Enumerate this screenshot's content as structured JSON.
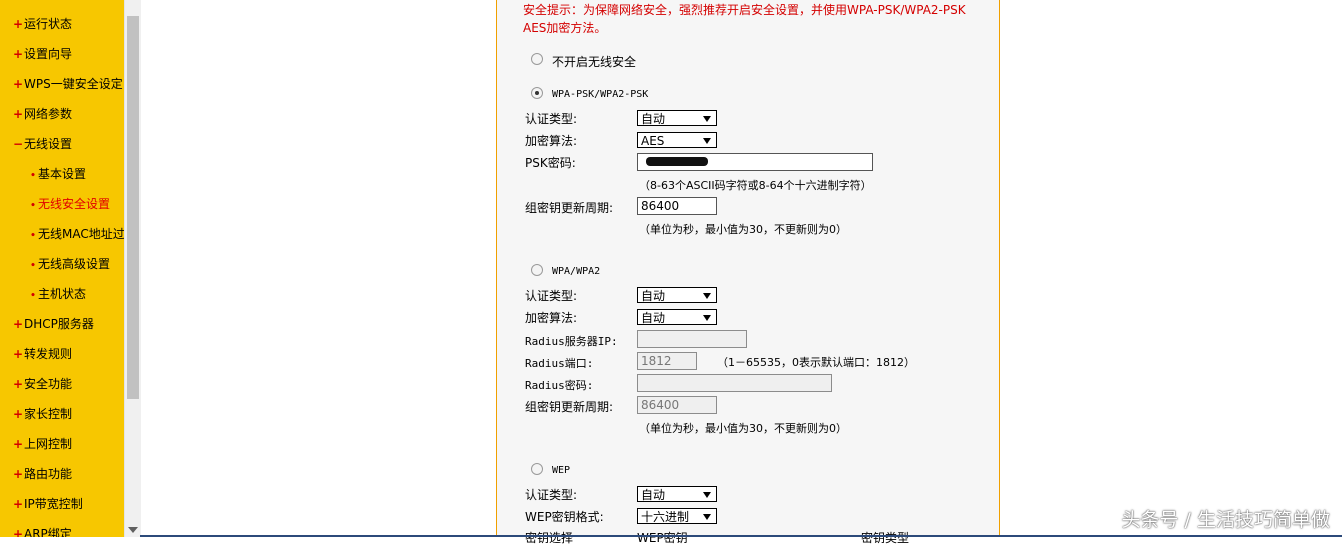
{
  "sidebar": {
    "items": [
      {
        "label": "运行状态",
        "mark": "+"
      },
      {
        "label": "设置向导",
        "mark": "+"
      },
      {
        "label": "WPS一键安全设定",
        "mark": "+"
      },
      {
        "label": "网络参数",
        "mark": "+"
      },
      {
        "label": "无线设置",
        "mark": "−"
      },
      {
        "label": "基本设置",
        "mark": "•"
      },
      {
        "label": "无线安全设置",
        "mark": "•"
      },
      {
        "label": "无线MAC地址过滤",
        "mark": "•"
      },
      {
        "label": "无线高级设置",
        "mark": "•"
      },
      {
        "label": "主机状态",
        "mark": "•"
      },
      {
        "label": "DHCP服务器",
        "mark": "+"
      },
      {
        "label": "转发规则",
        "mark": "+"
      },
      {
        "label": "安全功能",
        "mark": "+"
      },
      {
        "label": "家长控制",
        "mark": "+"
      },
      {
        "label": "上网控制",
        "mark": "+"
      },
      {
        "label": "路由功能",
        "mark": "+"
      },
      {
        "label": "IP带宽控制",
        "mark": "+"
      },
      {
        "label": "ARP绑定",
        "mark": "+"
      }
    ],
    "active_label": "无线安全设置"
  },
  "notice": "安全提示：为保障网络安全，强烈推荐开启安全设置，并使用WPA-PSK/WPA2-PSK AES加密方法。",
  "options": {
    "none": {
      "label": "不开启无线安全",
      "checked": false
    },
    "wpa_psk": {
      "label": "WPA-PSK/WPA2-PSK",
      "checked": true,
      "auth_type_label": "认证类型:",
      "auth_type_value": "自动",
      "cipher_label": "加密算法:",
      "cipher_value": "AES",
      "psk_label": "PSK密码:",
      "psk_hint": "（8-63个ASCII码字符或8-64个十六进制字符）",
      "rekey_label": "组密钥更新周期:",
      "rekey_value": "86400",
      "rekey_hint": "（单位为秒，最小值为30，不更新则为0）"
    },
    "wpa": {
      "label": "WPA/WPA2",
      "checked": false,
      "auth_type_label": "认证类型:",
      "auth_type_value": "自动",
      "cipher_label": "加密算法:",
      "cipher_value": "自动",
      "radius_ip_label": "Radius服务器IP:",
      "radius_port_label": "Radius端口:",
      "radius_port_value": "1812",
      "radius_port_hint": "（1－65535，0表示默认端口：1812）",
      "radius_pwd_label": "Radius密码:",
      "rekey_label": "组密钥更新周期:",
      "rekey_value": "86400",
      "rekey_hint": "（单位为秒，最小值为30，不更新则为0）"
    },
    "wep": {
      "label": "WEP",
      "checked": false,
      "auth_type_label": "认证类型:",
      "auth_type_value": "自动",
      "key_format_label": "WEP密钥格式:",
      "key_format_value": "十六进制",
      "col_key_select": "密钥选择",
      "col_wep_key": "WEP密钥",
      "col_key_type": "密钥类型"
    }
  },
  "watermark": "头条号 / 生活技巧简单做",
  "colors": {
    "sidebar_bg": "#f7c700",
    "notice": "#d40000",
    "panel_border": "#f0a000"
  }
}
